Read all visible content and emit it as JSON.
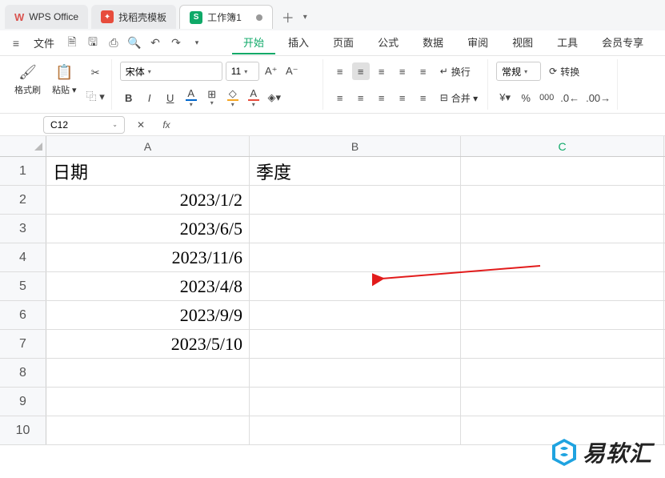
{
  "title_tabs": {
    "wps": "WPS Office",
    "docer": "找稻壳模板",
    "workbook": "工作簿1"
  },
  "menu": {
    "file": "文件",
    "tabs": [
      "开始",
      "插入",
      "页面",
      "公式",
      "数据",
      "审阅",
      "视图",
      "工具",
      "会员专享"
    ],
    "active_index": 0
  },
  "ribbon": {
    "format_painter": "格式刷",
    "paste": "粘贴",
    "font_name": "宋体",
    "font_size": "11",
    "bold": "B",
    "italic": "I",
    "underline": "U",
    "strikethrough": "A",
    "wrap": "换行",
    "merge": "合并",
    "general": "常规",
    "convert": "转换"
  },
  "formula_bar": {
    "name_box": "C12",
    "fx": "fx",
    "formula": ""
  },
  "grid": {
    "columns": [
      "A",
      "B",
      "C"
    ],
    "rows": [
      "1",
      "2",
      "3",
      "4",
      "5",
      "6",
      "7",
      "8",
      "9",
      "10"
    ],
    "header_A": "日期",
    "header_B": "季度",
    "data_A": [
      "2023/1/2",
      "2023/6/5",
      "2023/11/6",
      "2023/4/8",
      "2023/9/9",
      "2023/5/10"
    ]
  },
  "watermark": "易软汇"
}
